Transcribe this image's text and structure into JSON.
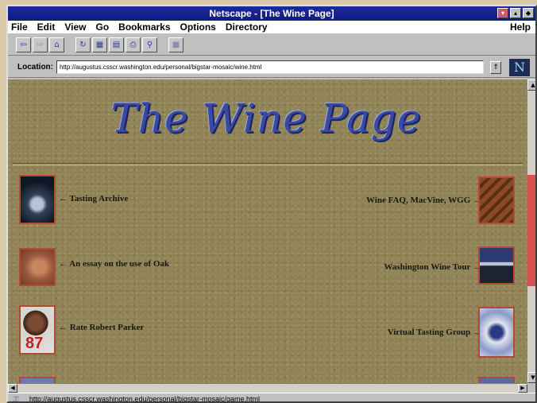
{
  "window": {
    "title": "Netscape - [The Wine Page]",
    "buttons": [
      "▾",
      "▴",
      "◆"
    ]
  },
  "menu": {
    "items": [
      "File",
      "Edit",
      "View",
      "Go",
      "Bookmarks",
      "Options",
      "Directory"
    ],
    "help": "Help"
  },
  "toolbar": {
    "icons": [
      "back-icon",
      "forward-icon",
      "home-icon",
      "reload-icon",
      "images-icon",
      "open-icon",
      "print-icon",
      "find-icon",
      "stop-icon"
    ]
  },
  "location": {
    "label": "Location:",
    "url": "http://augustus.csscr.washington.edu/personal/bigstar-mosaic/wine.html",
    "logo": "N"
  },
  "page": {
    "heading": "The Wine Page",
    "links_left": [
      {
        "label": "← Tasting Archive",
        "image": "dark-figure-photo"
      },
      {
        "label": "← An essay on the use of Oak",
        "image": "oak-barrel-photo"
      },
      {
        "label": "← Rate Robert Parker",
        "image": "robert-parker-photo",
        "image_text": "87"
      }
    ],
    "links_right": [
      {
        "label": "Wine FAQ, MacVine, WGG →",
        "image": "wine-cellar-photo"
      },
      {
        "label": "Washington Wine Tour →",
        "image": "mountain-landscape-photo"
      },
      {
        "label": "Virtual Tasting Group →",
        "image": "abstract-glass-photo"
      }
    ]
  },
  "status": {
    "url": "http://augustus.csscr.washington.edu/personal/bigstar-mosaic/game.html"
  },
  "colors": {
    "titlebar": "#101c80",
    "page_background": "#8f8356",
    "heading": "#3a4aa0",
    "image_border": "#b34a36"
  }
}
